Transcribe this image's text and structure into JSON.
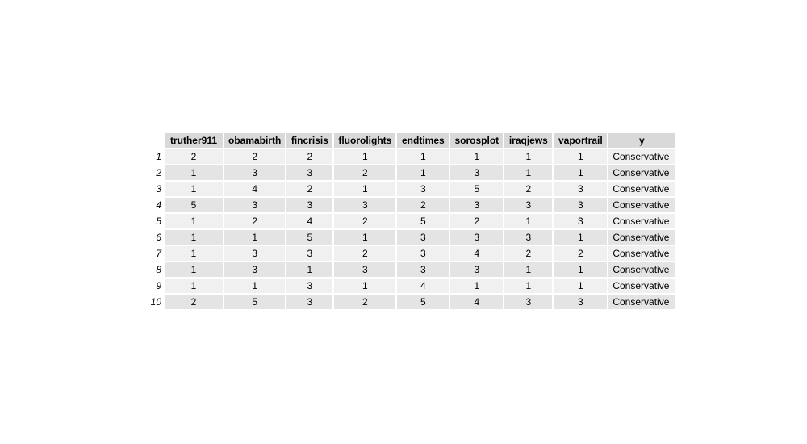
{
  "chart_data": {
    "type": "table",
    "columns": [
      "truther911",
      "obamabirth",
      "fincrisis",
      "fluorolights",
      "endtimes",
      "sorosplot",
      "iraqjews",
      "vaportrail",
      "y"
    ],
    "row_labels": [
      "1",
      "2",
      "3",
      "4",
      "5",
      "6",
      "7",
      "8",
      "9",
      "10"
    ],
    "rows": [
      [
        "2",
        "2",
        "2",
        "1",
        "1",
        "1",
        "1",
        "1",
        "Conservative"
      ],
      [
        "1",
        "3",
        "3",
        "2",
        "1",
        "3",
        "1",
        "1",
        "Conservative"
      ],
      [
        "1",
        "4",
        "2",
        "1",
        "3",
        "5",
        "2",
        "3",
        "Conservative"
      ],
      [
        "5",
        "3",
        "3",
        "3",
        "2",
        "3",
        "3",
        "3",
        "Conservative"
      ],
      [
        "1",
        "2",
        "4",
        "2",
        "5",
        "2",
        "1",
        "3",
        "Conservative"
      ],
      [
        "1",
        "1",
        "5",
        "1",
        "3",
        "3",
        "3",
        "1",
        "Conservative"
      ],
      [
        "1",
        "3",
        "3",
        "2",
        "3",
        "4",
        "2",
        "2",
        "Conservative"
      ],
      [
        "1",
        "3",
        "1",
        "3",
        "3",
        "3",
        "1",
        "1",
        "Conservative"
      ],
      [
        "1",
        "1",
        "3",
        "1",
        "4",
        "1",
        "1",
        "1",
        "Conservative"
      ],
      [
        "2",
        "5",
        "3",
        "2",
        "5",
        "4",
        "3",
        "3",
        "Conservative"
      ]
    ],
    "colors": {
      "header_bg": "#d9d9d9",
      "row_odd_bg": "#f0f0f0",
      "row_even_bg": "#e4e4e4"
    }
  }
}
